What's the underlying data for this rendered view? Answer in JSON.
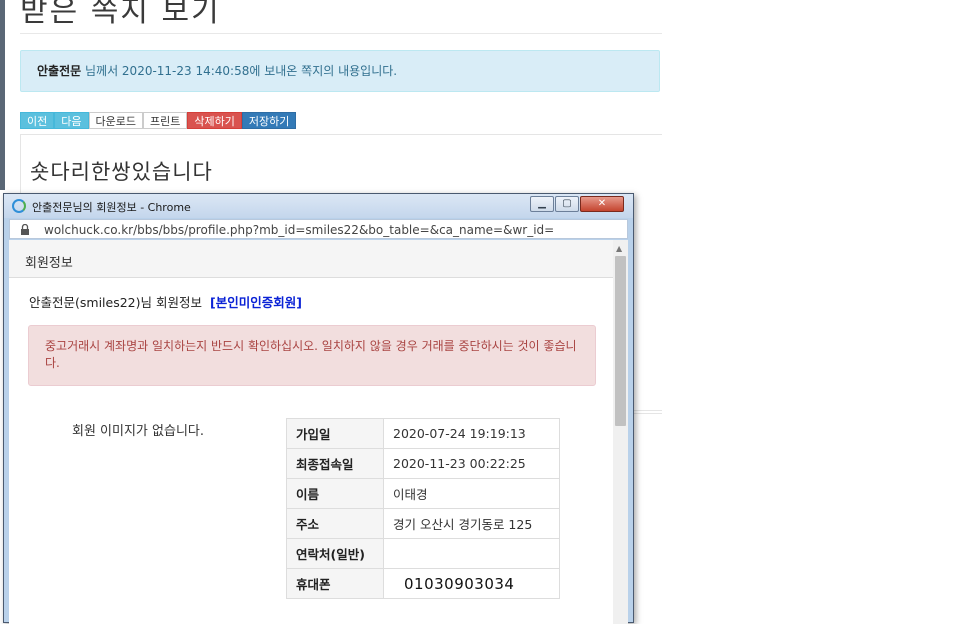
{
  "page": {
    "title": "받은 쪽지 보기",
    "alert_sender": "안출전문",
    "alert_mid": " 님께서 ",
    "alert_datetime": "2020-11-23 14:40:58",
    "alert_tail": "에 보내온 쪽지의 내용입니다.",
    "buttons": {
      "prev": "이전",
      "next": "다음",
      "download": "다운로드",
      "print": "프린트",
      "delete": "삭제하기",
      "save": "저장하기"
    },
    "message_title": "숏다리한쌍있습니다"
  },
  "popup": {
    "window_title": "안출전문님의 회원정보 - Chrome",
    "url": "wolchuck.co.kr/bbs/bbs/profile.php?mb_id=smiles22&bo_table=&ca_name=&wr_id=",
    "panel_heading": "회원정보",
    "profile_name": "안출전문(smiles22)님 회원정보",
    "verified_badge": "[본인미인증회원]",
    "warning": "중고거래시 계좌명과 일치하는지 반드시 확인하십시오. 일치하지 않을 경우 거래를 중단하시는 것이 좋습니다.",
    "no_image": "회원 이미지가 없습니다.",
    "rows": [
      {
        "label": "가입일",
        "value": "2020-07-24 19:19:13"
      },
      {
        "label": "최종접속일",
        "value": "2020-11-23 00:22:25"
      },
      {
        "label": "이름",
        "value": "이태경"
      },
      {
        "label": "주소",
        "value": "경기 오산시 경기동로 125"
      },
      {
        "label": "연락처(일반)",
        "value": ""
      },
      {
        "label": "휴대폰",
        "value": "01030903034"
      }
    ]
  }
}
